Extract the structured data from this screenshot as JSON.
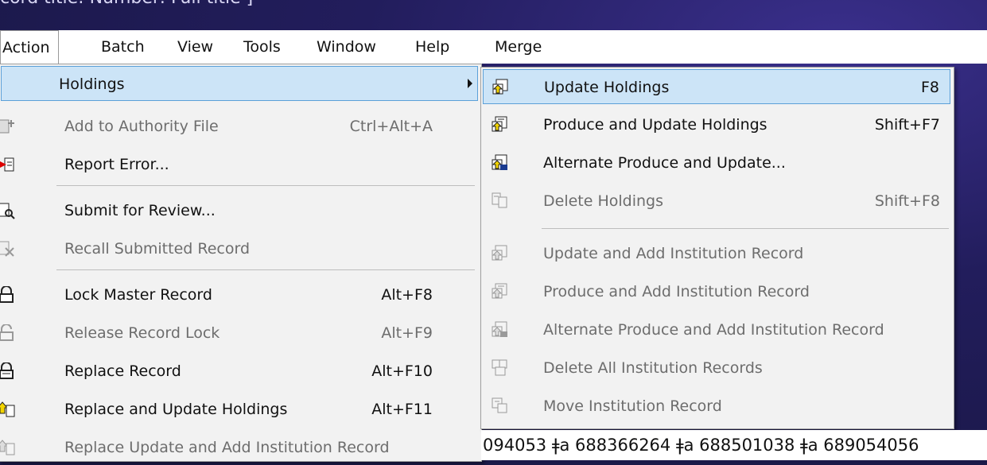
{
  "titlebar": {
    "text": "cord title: Number: Full title ]"
  },
  "menubar": {
    "items": [
      "Action",
      "Batch",
      "View",
      "Tools",
      "Window",
      "Help",
      "Merge"
    ]
  },
  "action_menu": {
    "items": [
      {
        "label": "Holdings",
        "shortcut": "",
        "icon": "none",
        "disabled": false,
        "highlight": true,
        "submenu": true
      },
      {
        "label": "Add to Authority File",
        "shortcut": "Ctrl+Alt+A",
        "icon": "authority-icon",
        "disabled": true
      },
      {
        "label": "Report Error...",
        "shortcut": "",
        "icon": "report-error-icon",
        "disabled": false
      },
      {
        "label": "Submit for Review...",
        "shortcut": "",
        "icon": "submit-review-icon",
        "disabled": false
      },
      {
        "label": "Recall Submitted Record",
        "shortcut": "",
        "icon": "recall-icon",
        "disabled": true
      },
      {
        "label": "Lock Master Record",
        "shortcut": "Alt+F8",
        "icon": "lock-icon",
        "disabled": false
      },
      {
        "label": "Release Record Lock",
        "shortcut": "Alt+F9",
        "icon": "unlock-icon",
        "disabled": true
      },
      {
        "label": "Replace Record",
        "shortcut": "Alt+F10",
        "icon": "replace-icon",
        "disabled": false
      },
      {
        "label": "Replace and Update Holdings",
        "shortcut": "Alt+F11",
        "icon": "replace-update-icon",
        "disabled": false
      },
      {
        "label": "Replace Update and Add Institution Record",
        "shortcut": "",
        "icon": "replace-add-icon",
        "disabled": true
      }
    ]
  },
  "holdings_menu": {
    "items": [
      {
        "label": "Update Holdings",
        "shortcut": "F8",
        "icon": "update-holdings-icon",
        "disabled": false,
        "highlight": true
      },
      {
        "label": "Produce and Update Holdings",
        "shortcut": "Shift+F7",
        "icon": "produce-update-icon",
        "disabled": false
      },
      {
        "label": "Alternate Produce and Update...",
        "shortcut": "",
        "icon": "alternate-produce-icon",
        "disabled": false
      },
      {
        "label": "Delete Holdings",
        "shortcut": "Shift+F8",
        "icon": "delete-holdings-icon",
        "disabled": true
      },
      {
        "label": "Update and Add Institution Record",
        "shortcut": "",
        "icon": "update-add-institution-icon",
        "disabled": true
      },
      {
        "label": "Produce and Add Institution Record",
        "shortcut": "",
        "icon": "produce-add-institution-icon",
        "disabled": true
      },
      {
        "label": "Alternate Produce and Add Institution Record",
        "shortcut": "",
        "icon": "alternate-add-institution-icon",
        "disabled": true
      },
      {
        "label": "Delete All Institution Records",
        "shortcut": "",
        "icon": "delete-all-institution-icon",
        "disabled": true
      },
      {
        "label": "Move Institution Record",
        "shortcut": "",
        "icon": "move-institution-icon",
        "disabled": true
      }
    ]
  },
  "record_text": {
    "value": "094053 ǂa 688366264 ǂa 688501038 ǂa 689054056"
  }
}
